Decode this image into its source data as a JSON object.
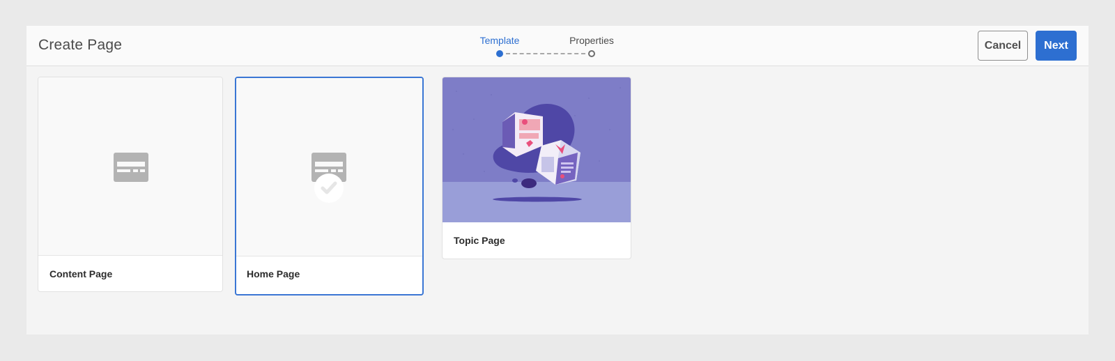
{
  "header": {
    "title": "Create Page",
    "cancel_label": "Cancel",
    "next_label": "Next"
  },
  "wizard": {
    "steps": [
      {
        "label": "Template",
        "state": "active"
      },
      {
        "label": "Properties",
        "state": "pending"
      }
    ]
  },
  "templates": [
    {
      "label": "Content Page",
      "thumbnail": "template-icon",
      "selected": false
    },
    {
      "label": "Home Page",
      "thumbnail": "template-icon",
      "selected": true
    },
    {
      "label": "Topic Page",
      "thumbnail": "floating-cubes-illustration",
      "selected": false
    }
  ],
  "colors": {
    "accent": "#2d6fd1",
    "selected_border": "#3a76d4",
    "illustration_bg": "#7e7dc7",
    "illustration_floor": "#999ed8"
  }
}
